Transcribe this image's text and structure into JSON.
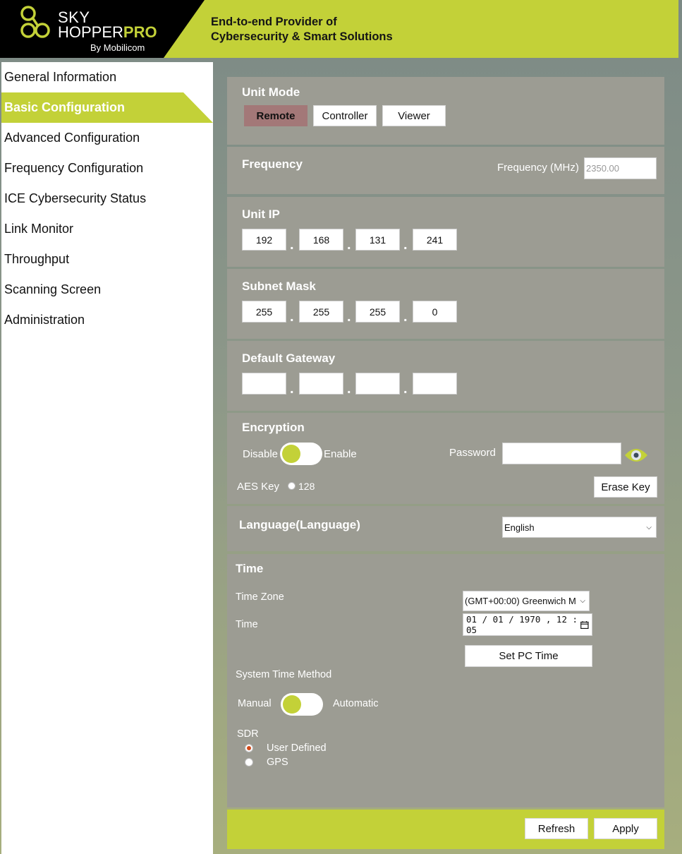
{
  "header": {
    "logo_sky": "SKY",
    "logo_hopper": "HOPPER",
    "logo_pro": "PRO",
    "logo_by": "By Mobilicom",
    "tagline_line1": "End-to-end Provider of",
    "tagline_line2": "Cybersecurity & Smart Solutions"
  },
  "sidebar": {
    "items": [
      {
        "label": "General Information"
      },
      {
        "label": "Basic Configuration",
        "active": true
      },
      {
        "label": "Advanced Configuration"
      },
      {
        "label": "Frequency Configuration"
      },
      {
        "label": "ICE Cybersecurity Status"
      },
      {
        "label": "Link Monitor"
      },
      {
        "label": "Throughput"
      },
      {
        "label": "Scanning Screen"
      },
      {
        "label": "Administration"
      }
    ]
  },
  "unit_mode": {
    "title": "Unit Mode",
    "options": [
      "Remote",
      "Controller",
      "Viewer"
    ],
    "selected": "Remote"
  },
  "frequency": {
    "title": "Frequency",
    "label": "Frequency (MHz)",
    "value": "2350.00"
  },
  "unit_ip": {
    "title": "Unit IP",
    "octets": [
      "192",
      "168",
      "131",
      "241"
    ]
  },
  "subnet_mask": {
    "title": "Subnet Mask",
    "octets": [
      "255",
      "255",
      "255",
      "0"
    ]
  },
  "default_gateway": {
    "title": "Default Gateway",
    "octets": [
      "",
      "",
      "",
      ""
    ]
  },
  "encryption": {
    "title": "Encryption",
    "disable_label": "Disable",
    "enable_label": "Enable",
    "password_label": "Password",
    "password_value": "",
    "aes_label": "AES Key",
    "aes_option": "128",
    "erase_button": "Erase Key",
    "eye_icon": "eye-icon"
  },
  "language": {
    "title": "Language(Language)",
    "selected": "English"
  },
  "time": {
    "title": "Time",
    "zone_label": "Time Zone",
    "zone_value": "(GMT+00:00) Greenwich M",
    "time_label": "Time",
    "time_value": "01 / 01 / 1970 ,  12 : 05",
    "set_pc_button": "Set PC Time",
    "method_label": "System Time Method",
    "manual_label": "Manual",
    "automatic_label": "Automatic",
    "sdr_label": "SDR",
    "sdr_options": [
      "User Defined",
      "GPS"
    ],
    "sdr_selected": "User Defined"
  },
  "footer": {
    "refresh_button": "Refresh",
    "apply_button": "Apply"
  },
  "colors": {
    "accent": "#c3d138",
    "panel": "#9c9c93",
    "selected_mode": "#a37878"
  }
}
